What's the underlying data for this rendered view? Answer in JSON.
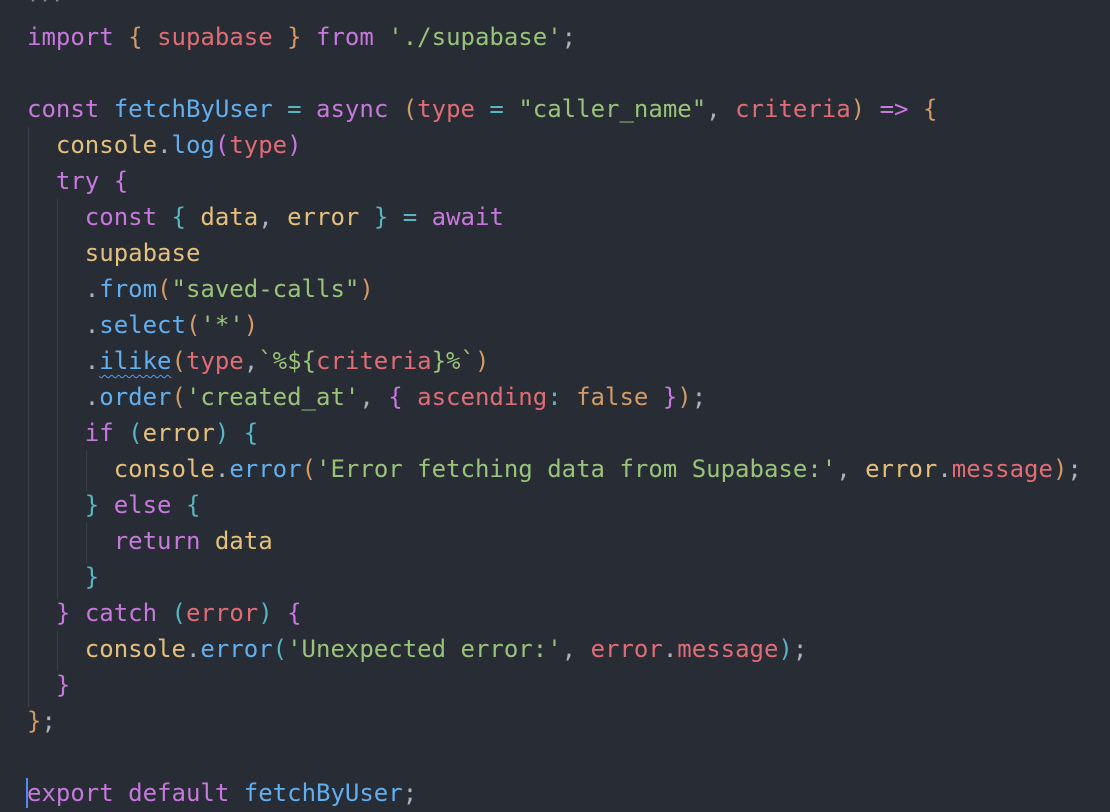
{
  "editor": {
    "colors": {
      "background": "#282c34",
      "keyword": "#c678dd",
      "function": "#61afef",
      "variable": "#e5c07b",
      "parameter": "#e06c75",
      "string": "#98c379",
      "operator": "#56b6c2",
      "boolean": "#d19a66",
      "cursor": "#528bff"
    },
    "lines": [
      [
        {
          "t": "···",
          "c": "punc"
        }
      ],
      [
        {
          "t": "import",
          "c": "kw"
        },
        {
          "t": " "
        },
        {
          "t": "{",
          "c": "br1"
        },
        {
          "t": " "
        },
        {
          "t": "supabase",
          "c": "param"
        },
        {
          "t": " "
        },
        {
          "t": "}",
          "c": "br1"
        },
        {
          "t": " "
        },
        {
          "t": "from",
          "c": "kw"
        },
        {
          "t": " "
        },
        {
          "t": "'./supabase'",
          "c": "str"
        },
        {
          "t": ";",
          "c": "punc"
        }
      ],
      [],
      [
        {
          "t": "const",
          "c": "kw"
        },
        {
          "t": " "
        },
        {
          "t": "fetchByUser",
          "c": "fn"
        },
        {
          "t": " "
        },
        {
          "t": "=",
          "c": "op"
        },
        {
          "t": " "
        },
        {
          "t": "async",
          "c": "kw"
        },
        {
          "t": " "
        },
        {
          "t": "(",
          "c": "br1"
        },
        {
          "t": "type",
          "c": "param"
        },
        {
          "t": " "
        },
        {
          "t": "=",
          "c": "op"
        },
        {
          "t": " "
        },
        {
          "t": "\"caller_name\"",
          "c": "str"
        },
        {
          "t": ", "
        },
        {
          "t": "criteria",
          "c": "param"
        },
        {
          "t": ")",
          "c": "br1"
        },
        {
          "t": " "
        },
        {
          "t": "=>",
          "c": "kw"
        },
        {
          "t": " "
        },
        {
          "t": "{",
          "c": "br1"
        }
      ],
      [
        {
          "t": "  "
        },
        {
          "t": "console",
          "c": "var"
        },
        {
          "t": ".",
          "c": "punc"
        },
        {
          "t": "log",
          "c": "fn"
        },
        {
          "t": "(",
          "c": "br2"
        },
        {
          "t": "type",
          "c": "param"
        },
        {
          "t": ")",
          "c": "br2"
        }
      ],
      [
        {
          "t": "  "
        },
        {
          "t": "try",
          "c": "kw"
        },
        {
          "t": " "
        },
        {
          "t": "{",
          "c": "br2"
        }
      ],
      [
        {
          "t": "    "
        },
        {
          "t": "const",
          "c": "kw"
        },
        {
          "t": " "
        },
        {
          "t": "{",
          "c": "br3"
        },
        {
          "t": " "
        },
        {
          "t": "data",
          "c": "var"
        },
        {
          "t": ", "
        },
        {
          "t": "error",
          "c": "var"
        },
        {
          "t": " "
        },
        {
          "t": "}",
          "c": "br3"
        },
        {
          "t": " "
        },
        {
          "t": "=",
          "c": "op"
        },
        {
          "t": " "
        },
        {
          "t": "await",
          "c": "kw"
        }
      ],
      [
        {
          "t": "    "
        },
        {
          "t": "supabase",
          "c": "var"
        }
      ],
      [
        {
          "t": "    "
        },
        {
          "t": ".",
          "c": "punc"
        },
        {
          "t": "from",
          "c": "fn"
        },
        {
          "t": "(",
          "c": "br1"
        },
        {
          "t": "\"saved-calls\"",
          "c": "str"
        },
        {
          "t": ")",
          "c": "br1"
        }
      ],
      [
        {
          "t": "    "
        },
        {
          "t": ".",
          "c": "punc"
        },
        {
          "t": "select",
          "c": "fn"
        },
        {
          "t": "(",
          "c": "br1"
        },
        {
          "t": "'*'",
          "c": "str"
        },
        {
          "t": ")",
          "c": "br1"
        }
      ],
      [
        {
          "t": "    "
        },
        {
          "t": ".",
          "c": "punc"
        },
        {
          "t": "ilike",
          "c": "fn",
          "squiggle": true
        },
        {
          "t": "(",
          "c": "br1"
        },
        {
          "t": "type",
          "c": "param"
        },
        {
          "t": ","
        },
        {
          "t": "`%${",
          "c": "str"
        },
        {
          "t": "criteria",
          "c": "param"
        },
        {
          "t": "}%`",
          "c": "str"
        },
        {
          "t": ")",
          "c": "br1"
        }
      ],
      [
        {
          "t": "    "
        },
        {
          "t": ".",
          "c": "punc"
        },
        {
          "t": "order",
          "c": "fn"
        },
        {
          "t": "(",
          "c": "br1"
        },
        {
          "t": "'created_at'",
          "c": "str"
        },
        {
          "t": ", "
        },
        {
          "t": "{",
          "c": "br2"
        },
        {
          "t": " "
        },
        {
          "t": "ascending",
          "c": "param"
        },
        {
          "t": ":",
          "c": "op"
        },
        {
          "t": " "
        },
        {
          "t": "false",
          "c": "bool"
        },
        {
          "t": " "
        },
        {
          "t": "}",
          "c": "br2"
        },
        {
          "t": ")",
          "c": "br1"
        },
        {
          "t": ";",
          "c": "punc"
        }
      ],
      [
        {
          "t": "    "
        },
        {
          "t": "if",
          "c": "kw"
        },
        {
          "t": " "
        },
        {
          "t": "(",
          "c": "br3"
        },
        {
          "t": "error",
          "c": "var"
        },
        {
          "t": ")",
          "c": "br3"
        },
        {
          "t": " "
        },
        {
          "t": "{",
          "c": "br3"
        }
      ],
      [
        {
          "t": "      "
        },
        {
          "t": "console",
          "c": "var"
        },
        {
          "t": ".",
          "c": "punc"
        },
        {
          "t": "error",
          "c": "fn"
        },
        {
          "t": "(",
          "c": "br1"
        },
        {
          "t": "'Error fetching data from Supabase:'",
          "c": "str"
        },
        {
          "t": ", "
        },
        {
          "t": "error",
          "c": "var"
        },
        {
          "t": ".",
          "c": "punc"
        },
        {
          "t": "message",
          "c": "param"
        },
        {
          "t": ")",
          "c": "br1"
        },
        {
          "t": ";",
          "c": "punc"
        }
      ],
      [
        {
          "t": "    "
        },
        {
          "t": "}",
          "c": "br3"
        },
        {
          "t": " "
        },
        {
          "t": "else",
          "c": "kw"
        },
        {
          "t": " "
        },
        {
          "t": "{",
          "c": "br3"
        }
      ],
      [
        {
          "t": "      "
        },
        {
          "t": "return",
          "c": "kw"
        },
        {
          "t": " "
        },
        {
          "t": "data",
          "c": "var"
        }
      ],
      [
        {
          "t": "    "
        },
        {
          "t": "}",
          "c": "br3"
        }
      ],
      [
        {
          "t": "  "
        },
        {
          "t": "}",
          "c": "br2"
        },
        {
          "t": " "
        },
        {
          "t": "catch",
          "c": "kw"
        },
        {
          "t": " "
        },
        {
          "t": "(",
          "c": "br3"
        },
        {
          "t": "error",
          "c": "param"
        },
        {
          "t": ")",
          "c": "br3"
        },
        {
          "t": " "
        },
        {
          "t": "{",
          "c": "br2"
        }
      ],
      [
        {
          "t": "    "
        },
        {
          "t": "console",
          "c": "var"
        },
        {
          "t": ".",
          "c": "punc"
        },
        {
          "t": "error",
          "c": "fn"
        },
        {
          "t": "(",
          "c": "br3"
        },
        {
          "t": "'Unexpected error:'",
          "c": "str"
        },
        {
          "t": ", "
        },
        {
          "t": "error",
          "c": "param"
        },
        {
          "t": ".",
          "c": "punc"
        },
        {
          "t": "message",
          "c": "param"
        },
        {
          "t": ")",
          "c": "br3"
        },
        {
          "t": ";",
          "c": "punc"
        }
      ],
      [
        {
          "t": "  "
        },
        {
          "t": "}",
          "c": "br2"
        }
      ],
      [
        {
          "t": "}",
          "c": "br1"
        },
        {
          "t": ";",
          "c": "punc"
        }
      ],
      [],
      [
        {
          "t": "export",
          "c": "kw"
        },
        {
          "t": " "
        },
        {
          "t": "default",
          "c": "kw"
        },
        {
          "t": " "
        },
        {
          "t": "fetchByUser",
          "c": "fn"
        },
        {
          "t": ";",
          "c": "punc"
        }
      ]
    ]
  }
}
